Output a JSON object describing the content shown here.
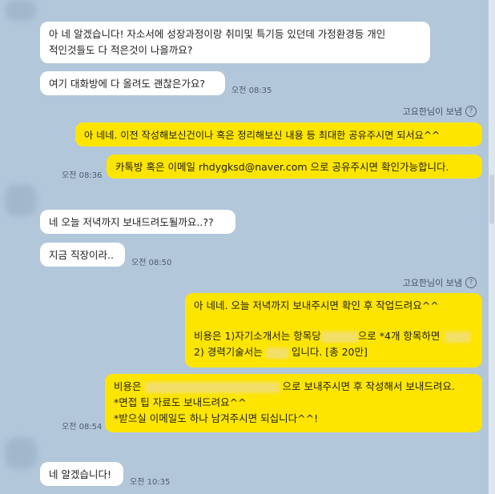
{
  "messages": {
    "m1": "아 네 알겠습니다! 자소서에 성장과정이랑 취미및 특기등 있던데 가정환경등 개인\n적인것들도 다 적은것이 나을까요?",
    "m2": "여기 대화방에 다 올려도 괜찮은가요?",
    "m2_time": "오전 08:35",
    "sender1": "고요한님이 보냄",
    "m3": "아 네네. 이전 작성해보신건이나 혹은 정리해보신 내용 등 최대한 공유주시면 되서요^^",
    "m4": "카톡방 혹은 이메일 rhdygksd@naver.com 으로 공유주시면 확인가능합니다.",
    "m4_time": "오전 08:36",
    "m5": "네 오늘 저녁까지 보내드려도될까요..??",
    "m6": "지금 직장이라..",
    "m6_time": "오전 08:50",
    "sender2": "고요한님이 보냄",
    "m7_line1": "아 네네. 오늘 저녁까지 보내주시면 확인 후 작업드려요^^",
    "m7_line3a": "비용은 1)자기소개서는 항목당",
    "m7_line3b": "으로 *4개 항목하면",
    "m7_line4a": "2) 경력기술서는",
    "m7_line4b": "입니다. [총 20만]",
    "m8_line1a": "비용은",
    "m8_line1b": "으로 보내주시면 후 작성해서 보내드려요.",
    "m8_line2": "*면접 팁 자료도 보내드려요^^",
    "m8_line3": "*받으실 이메일도 하나 남겨주시면 되십니다^^!",
    "m8_time": "오전 08:54",
    "m9": "네 알겠습니다!",
    "m9_time": "오전 10:35"
  },
  "icons": {
    "help": "?"
  }
}
